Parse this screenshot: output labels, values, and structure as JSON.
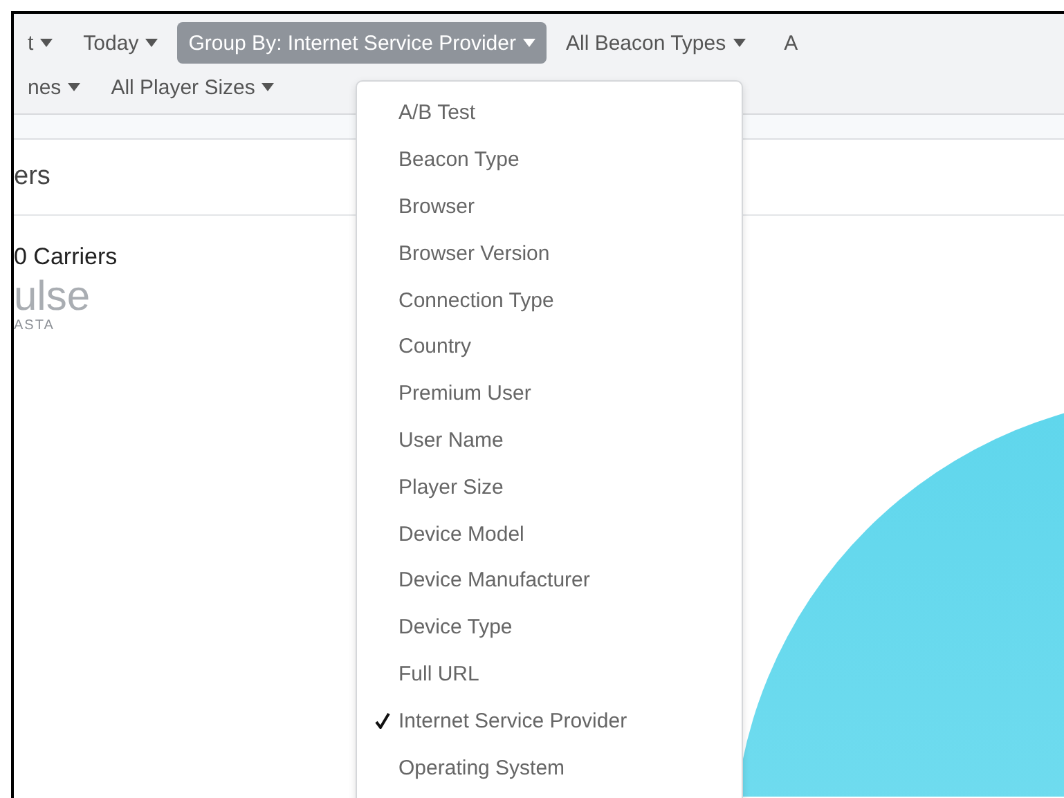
{
  "toolbar": {
    "rows": [
      [
        {
          "label": "t",
          "selected": false,
          "caret": true
        },
        {
          "label": "Today",
          "selected": false,
          "caret": true
        },
        {
          "label": "Group By: Internet Service Provider",
          "selected": true,
          "caret": true
        },
        {
          "label": "All Beacon Types",
          "selected": false,
          "caret": true
        },
        {
          "label": "A",
          "selected": false,
          "caret": false
        }
      ],
      [
        {
          "label": "nes",
          "selected": false,
          "caret": true
        },
        {
          "label": "All Player Sizes",
          "selected": false,
          "caret": true
        }
      ]
    ]
  },
  "panel": {
    "title": "ers",
    "chart_title": "0 Carriers",
    "logo": {
      "name": "ulse",
      "tagline": "ASTA"
    }
  },
  "menu": {
    "items": [
      {
        "label": "A/B Test",
        "checked": false
      },
      {
        "label": "Beacon Type",
        "checked": false
      },
      {
        "label": "Browser",
        "checked": false
      },
      {
        "label": "Browser Version",
        "checked": false
      },
      {
        "label": "Connection Type",
        "checked": false
      },
      {
        "label": "Country",
        "checked": false
      },
      {
        "label": "Premium User",
        "checked": false
      },
      {
        "label": "User Name",
        "checked": false
      },
      {
        "label": "Player Size",
        "checked": false
      },
      {
        "label": "Device Model",
        "checked": false
      },
      {
        "label": "Device Manufacturer",
        "checked": false
      },
      {
        "label": "Device Type",
        "checked": false
      },
      {
        "label": "Full URL",
        "checked": false
      },
      {
        "label": "Internet Service Provider",
        "checked": true
      },
      {
        "label": "Operating System",
        "checked": false
      }
    ]
  }
}
